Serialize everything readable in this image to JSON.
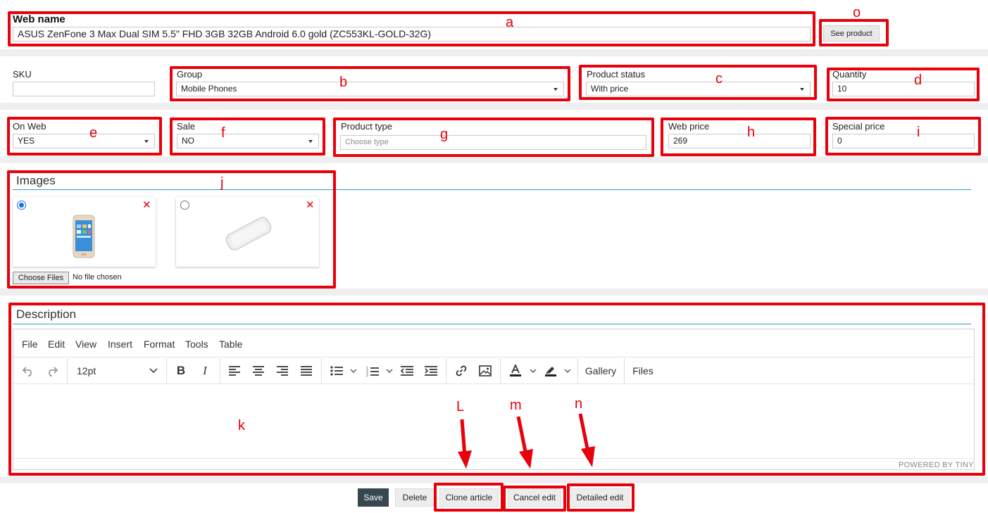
{
  "web_name": {
    "label": "Web name",
    "value": "ASUS ZenFone 3 Max Dual SIM 5.5\" FHD 3GB 32GB Android 6.0 gold (ZC553KL-GOLD-32G)",
    "see_product": "See product"
  },
  "fields": {
    "sku": {
      "label": "SKU",
      "value": ""
    },
    "group": {
      "label": "Group",
      "value": "Mobile Phones"
    },
    "product_status": {
      "label": "Product status",
      "value": "With price"
    },
    "quantity": {
      "label": "Quantity",
      "value": "10"
    },
    "on_web": {
      "label": "On Web",
      "value": "YES"
    },
    "sale": {
      "label": "Sale",
      "value": "NO"
    },
    "product_type": {
      "label": "Product type",
      "placeholder": "Choose type"
    },
    "web_price": {
      "label": "Web price",
      "value": "269"
    },
    "special_price": {
      "label": "Special price",
      "value": "0"
    }
  },
  "images": {
    "title": "Images",
    "choose_files": "Choose Files",
    "no_file": "No file chosen"
  },
  "description": {
    "title": "Description",
    "menu": [
      "File",
      "Edit",
      "View",
      "Insert",
      "Format",
      "Tools",
      "Table"
    ],
    "font_size": "12pt",
    "gallery": "Gallery",
    "files": "Files",
    "powered_by": "POWERED BY TINY"
  },
  "actions": {
    "save": "Save",
    "delete": "Delete",
    "clone": "Clone article",
    "cancel": "Cancel edit",
    "detailed": "Detailed edit"
  },
  "annotations": {
    "a": "a",
    "b": "b",
    "c": "c",
    "d": "d",
    "e": "e",
    "f": "f",
    "g": "g",
    "h": "h",
    "i": "i",
    "j": "j",
    "k": "k",
    "l": "L",
    "m": "m",
    "n": "n",
    "o": "o"
  },
  "colors": {
    "annotation_red": "#e8000b",
    "section_rule": "#2a9fc9",
    "save_button": "#37474f",
    "band_gray": "#efefef"
  }
}
